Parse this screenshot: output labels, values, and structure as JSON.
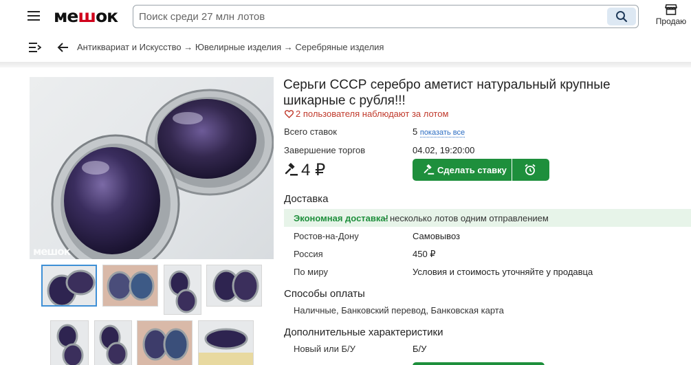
{
  "header": {
    "logo_text_start": "ме",
    "logo_text_mid": "ш",
    "logo_text_end": "ок",
    "search_placeholder": "Поиск среди 27 млн лотов",
    "sell_label": "Продаю"
  },
  "breadcrumb": {
    "path": "Антиквариат и Искусство → Ювелирные изделия → Серебряные изделия"
  },
  "gallery": {
    "watermark": "мешок",
    "thumbnail_count": 8,
    "active_index": 0
  },
  "lot": {
    "title": "Серьги СССР серебро аметист натуральный крупные шикарные с рубля!!!",
    "watchers": "2 пользователя наблюдают за лотом",
    "total_bids_label": "Всего ставок",
    "total_bids_value": "5",
    "show_all_link": "показать все",
    "end_label": "Завершение торгов",
    "end_value": "04.02, 19:20:00",
    "price": "4 ₽",
    "bid_button": "Сделать ставку"
  },
  "delivery": {
    "title": "Доставка",
    "eco_label": "Экономная доставка!",
    "eco_text": "- несколько лотов одним отправлением",
    "rows": [
      {
        "label": "Ростов-на-Дону",
        "value": "Самовывоз"
      },
      {
        "label": "Россия",
        "value": "450 ₽"
      },
      {
        "label": "По миру",
        "value": "Условия и стоимость уточняйте у продавца"
      }
    ]
  },
  "payment": {
    "title": "Способы оплаты",
    "methods": "Наличные, Банковский перевод, Банковская карта"
  },
  "specs": {
    "title": "Дополнительные характеристики",
    "rows": [
      {
        "label": "Новый или Б/У",
        "value": "Б/У"
      }
    ]
  },
  "colors": {
    "accent_green": "#1e8f3c",
    "link_blue": "#2a6cc2",
    "watch_red": "#c0392b",
    "eco_bg": "#e7f4e9",
    "amethyst": "#3b2f5c"
  }
}
